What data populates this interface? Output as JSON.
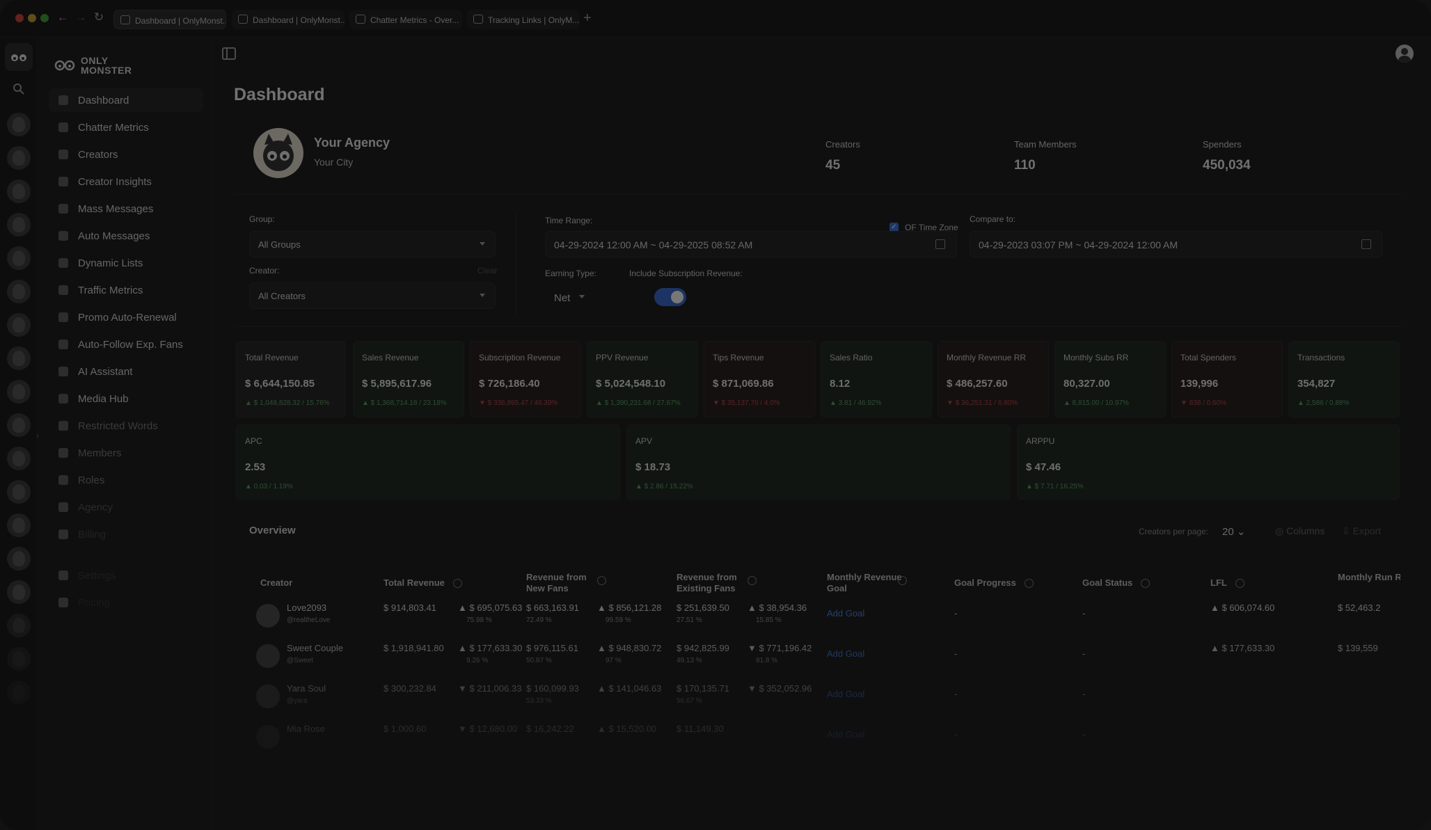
{
  "browser": {
    "tabs": [
      {
        "title": "Dashboard | OnlyMonst..."
      },
      {
        "title": "Dashboard | OnlyMonst..."
      },
      {
        "title": "Chatter Metrics - Over..."
      },
      {
        "title": "Tracking Links | OnlyM..."
      }
    ],
    "new_tab": "+"
  },
  "brand": {
    "line1": "ONLY",
    "line2": "MONSTER"
  },
  "sidebar": {
    "items": [
      {
        "label": "Dashboard",
        "icon": "dashboard-icon"
      },
      {
        "label": "Chatter Metrics",
        "icon": "chart-icon"
      },
      {
        "label": "Creators",
        "icon": "users-icon"
      },
      {
        "label": "Creator Insights",
        "icon": "bar-chart-icon"
      },
      {
        "label": "Mass Messages",
        "icon": "message-icon"
      },
      {
        "label": "Auto Messages",
        "icon": "bolt-icon"
      },
      {
        "label": "Dynamic Lists",
        "icon": "list-icon"
      },
      {
        "label": "Traffic Metrics",
        "icon": "traffic-icon"
      },
      {
        "label": "Promo Auto-Renewal",
        "icon": "promo-icon"
      },
      {
        "label": "Auto-Follow Exp. Fans",
        "icon": "follow-icon"
      },
      {
        "label": "AI Assistant",
        "icon": "ai-icon"
      },
      {
        "label": "Media Hub",
        "icon": "media-icon"
      },
      {
        "label": "Restricted Words",
        "icon": "restricted-icon"
      },
      {
        "label": "Members",
        "icon": "members-icon"
      },
      {
        "label": "Roles",
        "icon": "roles-icon"
      },
      {
        "label": "Agency",
        "icon": "agency-icon"
      },
      {
        "label": "Billing",
        "icon": "billing-icon"
      },
      {
        "label": "Settings",
        "icon": "settings-icon"
      },
      {
        "label": "Pricing",
        "icon": "pricing-icon"
      }
    ]
  },
  "page": {
    "title": "Dashboard"
  },
  "agency": {
    "name": "Your Agency",
    "city": "Your City",
    "stats": [
      {
        "label": "Creators",
        "value": "45"
      },
      {
        "label": "Team Members",
        "value": "110"
      },
      {
        "label": "Spenders",
        "value": "450,034"
      }
    ]
  },
  "filters": {
    "group_label": "Group:",
    "group_value": "All Groups",
    "creator_label": "Creator:",
    "creator_value": "All Creators",
    "creator_clear": "Clear",
    "time_range_label": "Time Range:",
    "time_range_value": "04-29-2024 12:00 AM ~ 04-29-2025 08:52 AM",
    "of_time_zone_label": "OF Time Zone",
    "of_time_zone_checked": true,
    "compare_label": "Compare to:",
    "compare_value": "04-29-2023 03:07 PM ~ 04-29-2024 12:00 AM",
    "earning_type_label": "Earning Type:",
    "earning_type_value": "Net",
    "include_sub_label": "Include Subscription Revenue:",
    "include_sub_on": true
  },
  "metrics": [
    {
      "title": "Total Revenue",
      "value": "$ 6,644,150.85",
      "delta": "▲ $ 1,048,828.32 / 15.76%",
      "trend": "up"
    },
    {
      "title": "Sales Revenue",
      "value": "$ 5,895,617.96",
      "delta": "▲ $ 1,368,714.18 / 23.18%",
      "trend": "up"
    },
    {
      "title": "Subscription Revenue",
      "value": "$ 726,186.40",
      "delta": "▼ $ 336,895.47 / 46.39%",
      "trend": "down"
    },
    {
      "title": "PPV Revenue",
      "value": "$ 5,024,548.10",
      "delta": "▲ $ 1,390,231.68 / 27.67%",
      "trend": "up"
    },
    {
      "title": "Tips Revenue",
      "value": "$ 871,069.86",
      "delta": "▼ $ 35,137.70 / 4.0%",
      "trend": "down"
    },
    {
      "title": "Sales Ratio",
      "value": "8.12",
      "delta": "▲ 3.81 / 46.92%",
      "trend": "up"
    },
    {
      "title": "Monthly Revenue RR",
      "value": "$ 486,257.60",
      "delta": "▼ $ 36,251.31 / 6.80%",
      "trend": "down"
    },
    {
      "title": "Monthly Subs RR",
      "value": "80,327.00",
      "delta": "▲ 8,815.00 / 10.97%",
      "trend": "up"
    },
    {
      "title": "Total Spenders",
      "value": "139,996",
      "delta": "▼ 838 / 0.60%",
      "trend": "down"
    },
    {
      "title": "Transactions",
      "value": "354,827",
      "delta": "▲ 2,586 / 0.88%",
      "trend": "up"
    },
    {
      "title": "APC",
      "value": "2.53",
      "delta": "▲ 0.03 / 1.19%",
      "trend": "up"
    },
    {
      "title": "APV",
      "value": "$ 18.73",
      "delta": "▲ $ 2.86 / 15.22%",
      "trend": "up"
    },
    {
      "title": "ARPPU",
      "value": "$ 47.46",
      "delta": "▲ $ 7.71 / 16.25%",
      "trend": "up"
    }
  ],
  "overview": {
    "title": "Overview",
    "per_page_label": "Creators per page:",
    "per_page_value": "20",
    "columns_label": "Columns",
    "export_label": "Export",
    "headers": [
      "Creator",
      "Total Revenue",
      "Revenue from New Fans",
      "Revenue from Existing Fans",
      "Monthly Revenue Goal",
      "Goal Progress",
      "Goal Status",
      "LFL",
      "Monthly Run Rate"
    ],
    "rows": [
      {
        "name": "Love2093",
        "handle": "@realtheLove",
        "total": "$ 914,803.41",
        "total_delta": "▲ $ 695,075.63",
        "total_pct": "75.98 %",
        "new": "$ 663,163.91",
        "new_delta": "▲ $ 856,121.28",
        "new_pct": "72.49 %",
        "new_pct2": "99.59 %",
        "existing": "$ 251,639.50",
        "existing_delta": "▲ $ 38,954.36",
        "existing_pct": "27.51 %",
        "existing_pct2": "15.85 %",
        "goal": "Add Goal",
        "progress": "-",
        "status": "-",
        "lfl": "▲ $ 606,074.60",
        "run_rate": "$ 52,463.2"
      },
      {
        "name": "Sweet Couple",
        "handle": "@Sweet",
        "total": "$ 1,918,941.80",
        "total_delta": "▲ $ 177,633.30",
        "total_pct": "9.26 %",
        "new": "$ 976,115.61",
        "new_delta": "▲ $ 948,830.72",
        "new_pct": "50.87 %",
        "new_pct2": "97 %",
        "existing": "$ 942,825.99",
        "existing_delta": "▼ $ 771,196.42",
        "existing_pct": "49.13 %",
        "existing_pct2": "81.8 %",
        "goal": "Add Goal",
        "progress": "-",
        "status": "-",
        "lfl": "▲ $ 177,633.30",
        "run_rate": "$ 139,559"
      },
      {
        "name": "Yara Soul",
        "handle": "@yara",
        "total": "$ 300,232.84",
        "total_delta": "▼ $ 211,006.33",
        "total_pct": "",
        "new": "$ 160,099.93",
        "new_delta": "▲ $ 141,046.63",
        "new_pct": "53.33 %",
        "new_pct2": "",
        "existing": "$ 170,135.71",
        "existing_delta": "▼ $ 352,052.96",
        "existing_pct": "56.67 %",
        "existing_pct2": "",
        "goal": "Add Goal",
        "progress": "-",
        "status": "-",
        "lfl": "",
        "run_rate": ""
      },
      {
        "name": "Mia Rose",
        "handle": "@mia",
        "total": "$ 1,000.60",
        "total_delta": "▼ $ 12,680.00",
        "total_pct": "",
        "new": "$ 16,242.22",
        "new_delta": "▲ $ 15,520.00",
        "new_pct": "",
        "new_pct2": "",
        "existing": "$ 11,149.30",
        "existing_delta": "",
        "existing_pct": "",
        "existing_pct2": "",
        "goal": "Add Goal",
        "progress": "-",
        "status": "-",
        "lfl": "",
        "run_rate": ""
      }
    ]
  }
}
